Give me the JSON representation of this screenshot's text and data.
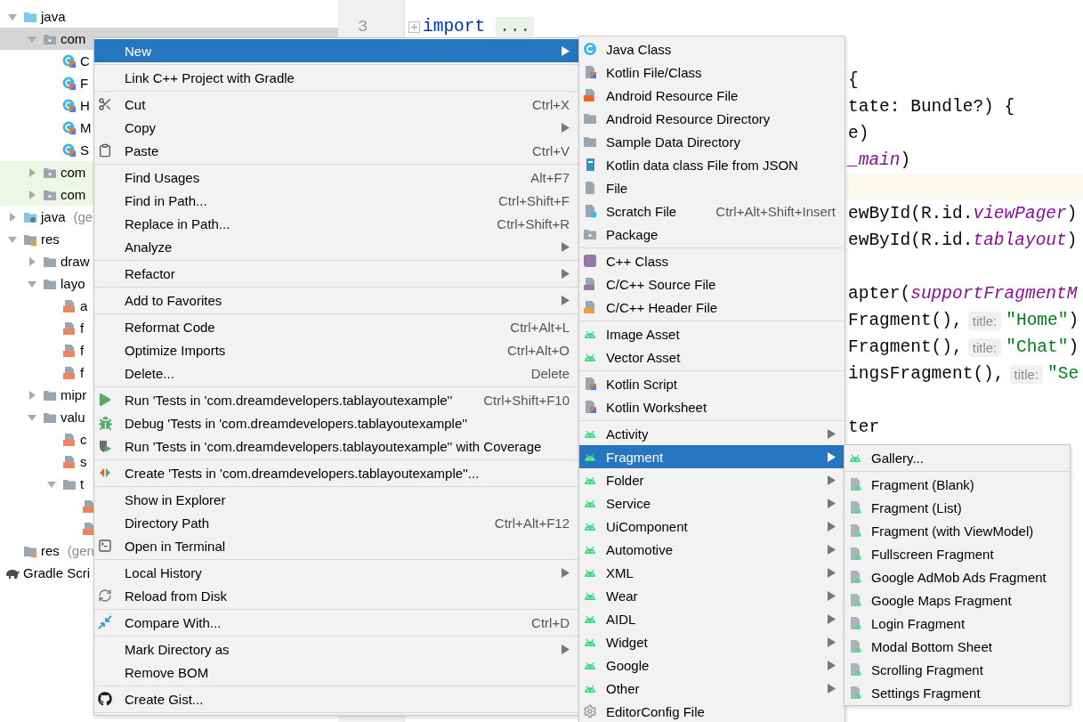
{
  "tree": [
    {
      "label": "java",
      "kind": "source-folder",
      "expanded": true,
      "selected": false,
      "children": [
        {
          "label": "com",
          "kind": "package",
          "expanded": true,
          "selected": true,
          "children": [
            {
              "label": "C",
              "kind": "kotlin-class",
              "selected": false
            },
            {
              "label": "F",
              "kind": "kotlin-class",
              "selected": false
            },
            {
              "label": "H",
              "kind": "kotlin-class",
              "selected": false
            },
            {
              "label": "M",
              "kind": "kotlin-class",
              "selected": false
            },
            {
              "label": "S",
              "kind": "kotlin-class",
              "selected": false
            }
          ]
        },
        {
          "label": "com",
          "kind": "package",
          "expanded": false,
          "selected": false,
          "tinted": true
        },
        {
          "label": "com",
          "kind": "package",
          "expanded": false,
          "selected": false,
          "tinted": true
        }
      ]
    },
    {
      "label": "java",
      "note": "(ge",
      "kind": "generated-folder",
      "expanded": false,
      "selected": false
    },
    {
      "label": "res",
      "kind": "res-folder",
      "expanded": true,
      "selected": false,
      "children": [
        {
          "label": "draw",
          "kind": "folder",
          "expanded": false,
          "selected": false
        },
        {
          "label": "layo",
          "kind": "folder",
          "expanded": true,
          "selected": false,
          "children": [
            {
              "label": "a",
              "kind": "layout-file",
              "selected": false
            },
            {
              "label": "f",
              "kind": "layout-file",
              "selected": false
            },
            {
              "label": "f",
              "kind": "layout-file",
              "selected": false
            },
            {
              "label": "f",
              "kind": "layout-file",
              "selected": false
            }
          ]
        },
        {
          "label": "mipr",
          "kind": "folder",
          "expanded": false,
          "selected": false
        },
        {
          "label": "valu",
          "kind": "folder",
          "expanded": true,
          "selected": false,
          "children": [
            {
              "label": "c",
              "kind": "layout-file",
              "selected": false
            },
            {
              "label": "s",
              "kind": "layout-file",
              "selected": false
            },
            {
              "label": "t",
              "kind": "folder",
              "expanded": true,
              "selected": false,
              "children": [
                {
                  "kind": "layout-file",
                  "selected": false
                },
                {
                  "kind": "layout-file",
                  "selected": false
                }
              ]
            }
          ]
        }
      ]
    },
    {
      "label": "res",
      "note": "(gen",
      "kind": "res-folder",
      "selected": false
    },
    {
      "label": "Gradle Scri",
      "kind": "gradle",
      "selected": false
    }
  ],
  "editor": {
    "rows": [
      {
        "parts": []
      },
      {
        "number": "3",
        "folded": true,
        "parts": [
          {
            "kind": "code",
            "tokens": [
              {
                "text": "import",
                "kind": "keyword"
              }
            ]
          },
          {
            "kind": "fold",
            "text": "..."
          }
        ]
      },
      {
        "parts": []
      },
      {
        "parts": [
          {
            "kind": "code",
            "tokens": [
              {
                "text": "{",
                "kind": "plain"
              }
            ]
          }
        ]
      },
      {
        "parts": [
          {
            "kind": "code",
            "tokens": [
              {
                "text": "tate: Bundle?) {",
                "kind": "plain"
              }
            ]
          }
        ]
      },
      {
        "parts": [
          {
            "kind": "code",
            "tokens": [
              {
                "text": "e)",
                "kind": "plain"
              }
            ]
          }
        ]
      },
      {
        "parts": [
          {
            "kind": "code",
            "tokens": [
              {
                "text": "_main",
                "kind": "field"
              },
              {
                "text": ")",
                "kind": "plain"
              }
            ]
          }
        ]
      },
      {
        "current": true,
        "parts": []
      },
      {
        "parts": [
          {
            "kind": "code",
            "tokens": [
              {
                "text": "ewById(R.id.",
                "kind": "plain"
              },
              {
                "text": "viewPager",
                "kind": "field"
              },
              {
                "text": ")",
                "kind": "plain"
              }
            ]
          }
        ]
      },
      {
        "parts": [
          {
            "kind": "code",
            "tokens": [
              {
                "text": "ewById(R.id.",
                "kind": "plain"
              },
              {
                "text": "tablayout",
                "kind": "field"
              },
              {
                "text": ")",
                "kind": "plain"
              }
            ]
          }
        ]
      },
      {
        "parts": []
      },
      {
        "parts": [
          {
            "kind": "code",
            "tokens": [
              {
                "text": "apter(",
                "kind": "plain"
              },
              {
                "text": "supportFragmentM",
                "kind": "field"
              }
            ]
          }
        ]
      },
      {
        "parts": [
          {
            "kind": "code",
            "tokens": [
              {
                "text": "Fragment(),",
                "kind": "plain"
              }
            ]
          },
          {
            "kind": "hint",
            "text": "title:"
          },
          {
            "kind": "code",
            "tokens": [
              {
                "text": "\"Home\"",
                "kind": "string"
              },
              {
                "text": ")",
                "kind": "plain"
              }
            ]
          }
        ]
      },
      {
        "parts": [
          {
            "kind": "code",
            "tokens": [
              {
                "text": "Fragment(),",
                "kind": "plain"
              }
            ]
          },
          {
            "kind": "hint",
            "text": "title:"
          },
          {
            "kind": "code",
            "tokens": [
              {
                "text": "\"Chat\"",
                "kind": "string"
              },
              {
                "text": ")",
                "kind": "plain"
              }
            ]
          }
        ]
      },
      {
        "parts": [
          {
            "kind": "code",
            "tokens": [
              {
                "text": "ingsFragment(),",
                "kind": "plain"
              }
            ]
          },
          {
            "kind": "hint",
            "text": "title:"
          },
          {
            "kind": "code",
            "tokens": [
              {
                "text": "\"Se",
                "kind": "string"
              }
            ]
          }
        ]
      },
      {
        "parts": []
      },
      {
        "parts": [
          {
            "kind": "code",
            "tokens": [
              {
                "text": "ter",
                "kind": "plain"
              }
            ]
          }
        ]
      }
    ]
  },
  "menus": [
    {
      "items": [
        {
          "kind": "plain",
          "label": "New",
          "submenu": true,
          "selected": true
        },
        {
          "kind": "sep"
        },
        {
          "kind": "plain",
          "label": "Link C++ Project with Gradle",
          "selected": false
        },
        {
          "kind": "sep"
        },
        {
          "kind": "scissors",
          "label": "Cut",
          "shortcut": "Ctrl+X",
          "selected": false
        },
        {
          "kind": "plain",
          "label": "Copy",
          "submenu": true,
          "selected": false
        },
        {
          "kind": "clipboard",
          "label": "Paste",
          "shortcut": "Ctrl+V",
          "selected": false
        },
        {
          "kind": "sep"
        },
        {
          "kind": "plain",
          "label": "Find Usages",
          "shortcut": "Alt+F7",
          "selected": false
        },
        {
          "kind": "plain",
          "label": "Find in Path...",
          "shortcut": "Ctrl+Shift+F",
          "selected": false
        },
        {
          "kind": "plain",
          "label": "Replace in Path...",
          "shortcut": "Ctrl+Shift+R",
          "selected": false
        },
        {
          "kind": "plain",
          "label": "Analyze",
          "submenu": true,
          "selected": false
        },
        {
          "kind": "sep"
        },
        {
          "kind": "plain",
          "label": "Refactor",
          "submenu": true,
          "selected": false
        },
        {
          "kind": "sep"
        },
        {
          "kind": "plain",
          "label": "Add to Favorites",
          "submenu": true,
          "selected": false
        },
        {
          "kind": "sep"
        },
        {
          "kind": "plain",
          "label": "Reformat Code",
          "shortcut": "Ctrl+Alt+L",
          "selected": false
        },
        {
          "kind": "plain",
          "label": "Optimize Imports",
          "shortcut": "Ctrl+Alt+O",
          "selected": false
        },
        {
          "kind": "plain",
          "label": "Delete...",
          "shortcut": "Delete",
          "selected": false
        },
        {
          "kind": "sep"
        },
        {
          "kind": "run",
          "label": "Run 'Tests in 'com.dreamdevelopers.tablayoutexample''",
          "shortcut": "Ctrl+Shift+F10",
          "selected": false
        },
        {
          "kind": "debug",
          "label": "Debug 'Tests in 'com.dreamdevelopers.tablayoutexample''",
          "selected": false
        },
        {
          "kind": "coverage",
          "label": "Run 'Tests in 'com.dreamdevelopers.tablayoutexample'' with Coverage",
          "selected": false
        },
        {
          "kind": "sep"
        },
        {
          "kind": "create-test",
          "label": "Create 'Tests in 'com.dreamdevelopers.tablayoutexample''...",
          "selected": false
        },
        {
          "kind": "sep"
        },
        {
          "kind": "plain",
          "label": "Show in Explorer",
          "selected": false
        },
        {
          "kind": "plain",
          "label": "Directory Path",
          "shortcut": "Ctrl+Alt+F12",
          "selected": false
        },
        {
          "kind": "terminal",
          "label": "Open in Terminal",
          "selected": false
        },
        {
          "kind": "sep"
        },
        {
          "kind": "plain",
          "label": "Local History",
          "submenu": true,
          "selected": false
        },
        {
          "kind": "reload",
          "label": "Reload from Disk",
          "selected": false
        },
        {
          "kind": "sep"
        },
        {
          "kind": "compare",
          "label": "Compare With...",
          "shortcut": "Ctrl+D",
          "selected": false
        },
        {
          "kind": "sep"
        },
        {
          "kind": "plain",
          "label": "Mark Directory as",
          "submenu": true,
          "selected": false
        },
        {
          "kind": "plain",
          "label": "Remove BOM",
          "selected": false
        },
        {
          "kind": "sep"
        },
        {
          "kind": "github",
          "label": "Create Gist...",
          "selected": false
        },
        {
          "kind": "sep"
        }
      ]
    },
    {
      "items": [
        {
          "kind": "java-class",
          "label": "Java Class",
          "selected": false
        },
        {
          "kind": "kotlin-file",
          "label": "Kotlin File/Class",
          "selected": false
        },
        {
          "kind": "resource-file",
          "label": "Android Resource File",
          "selected": false
        },
        {
          "kind": "folder",
          "label": "Android Resource Directory",
          "selected": false
        },
        {
          "kind": "folder",
          "label": "Sample Data Directory",
          "selected": false
        },
        {
          "kind": "kotlin-json",
          "label": "Kotlin data class File from JSON",
          "selected": false
        },
        {
          "kind": "file",
          "label": "File",
          "selected": false
        },
        {
          "kind": "scratch",
          "label": "Scratch File",
          "shortcut": "Ctrl+Alt+Shift+Insert",
          "selected": false
        },
        {
          "kind": "package",
          "label": "Package",
          "selected": false
        },
        {
          "kind": "sep"
        },
        {
          "kind": "cpp-class",
          "label": "C++ Class",
          "selected": false
        },
        {
          "kind": "cpp-source",
          "label": "C/C++ Source File",
          "selected": false
        },
        {
          "kind": "cpp-header",
          "label": "C/C++ Header File",
          "selected": false
        },
        {
          "kind": "sep"
        },
        {
          "kind": "android",
          "label": "Image Asset",
          "selected": false
        },
        {
          "kind": "android",
          "label": "Vector Asset",
          "selected": false
        },
        {
          "kind": "sep"
        },
        {
          "kind": "kotlin-file",
          "label": "Kotlin Script",
          "selected": false
        },
        {
          "kind": "kotlin-file",
          "label": "Kotlin Worksheet",
          "selected": false
        },
        {
          "kind": "sep"
        },
        {
          "kind": "android",
          "label": "Activity",
          "submenu": true,
          "selected": false
        },
        {
          "kind": "android",
          "label": "Fragment",
          "submenu": true,
          "selected": true
        },
        {
          "kind": "android",
          "label": "Folder",
          "submenu": true,
          "selected": false
        },
        {
          "kind": "android",
          "label": "Service",
          "submenu": true,
          "selected": false
        },
        {
          "kind": "android",
          "label": "UiComponent",
          "submenu": true,
          "selected": false
        },
        {
          "kind": "android",
          "label": "Automotive",
          "submenu": true,
          "selected": false
        },
        {
          "kind": "android",
          "label": "XML",
          "submenu": true,
          "selected": false
        },
        {
          "kind": "android",
          "label": "Wear",
          "submenu": true,
          "selected": false
        },
        {
          "kind": "android",
          "label": "AIDL",
          "submenu": true,
          "selected": false
        },
        {
          "kind": "android",
          "label": "Widget",
          "submenu": true,
          "selected": false
        },
        {
          "kind": "android",
          "label": "Google",
          "submenu": true,
          "selected": false
        },
        {
          "kind": "android",
          "label": "Other",
          "submenu": true,
          "selected": false
        },
        {
          "kind": "gear",
          "label": "EditorConfig File",
          "selected": false
        }
      ]
    },
    {
      "items": [
        {
          "kind": "android",
          "label": "Gallery...",
          "selected": false
        },
        {
          "kind": "sep"
        },
        {
          "kind": "template",
          "label": "Fragment (Blank)",
          "selected": false
        },
        {
          "kind": "template",
          "label": "Fragment (List)",
          "selected": false
        },
        {
          "kind": "template",
          "label": "Fragment (with ViewModel)",
          "selected": false
        },
        {
          "kind": "template",
          "label": "Fullscreen Fragment",
          "selected": false
        },
        {
          "kind": "template",
          "label": "Google AdMob Ads Fragment",
          "selected": false
        },
        {
          "kind": "template",
          "label": "Google Maps Fragment",
          "selected": false
        },
        {
          "kind": "template",
          "label": "Login Fragment",
          "selected": false
        },
        {
          "kind": "template",
          "label": "Modal Bottom Sheet",
          "selected": false
        },
        {
          "kind": "template",
          "label": "Scrolling Fragment",
          "selected": false
        },
        {
          "kind": "template",
          "label": "Settings Fragment",
          "selected": false
        }
      ]
    }
  ]
}
